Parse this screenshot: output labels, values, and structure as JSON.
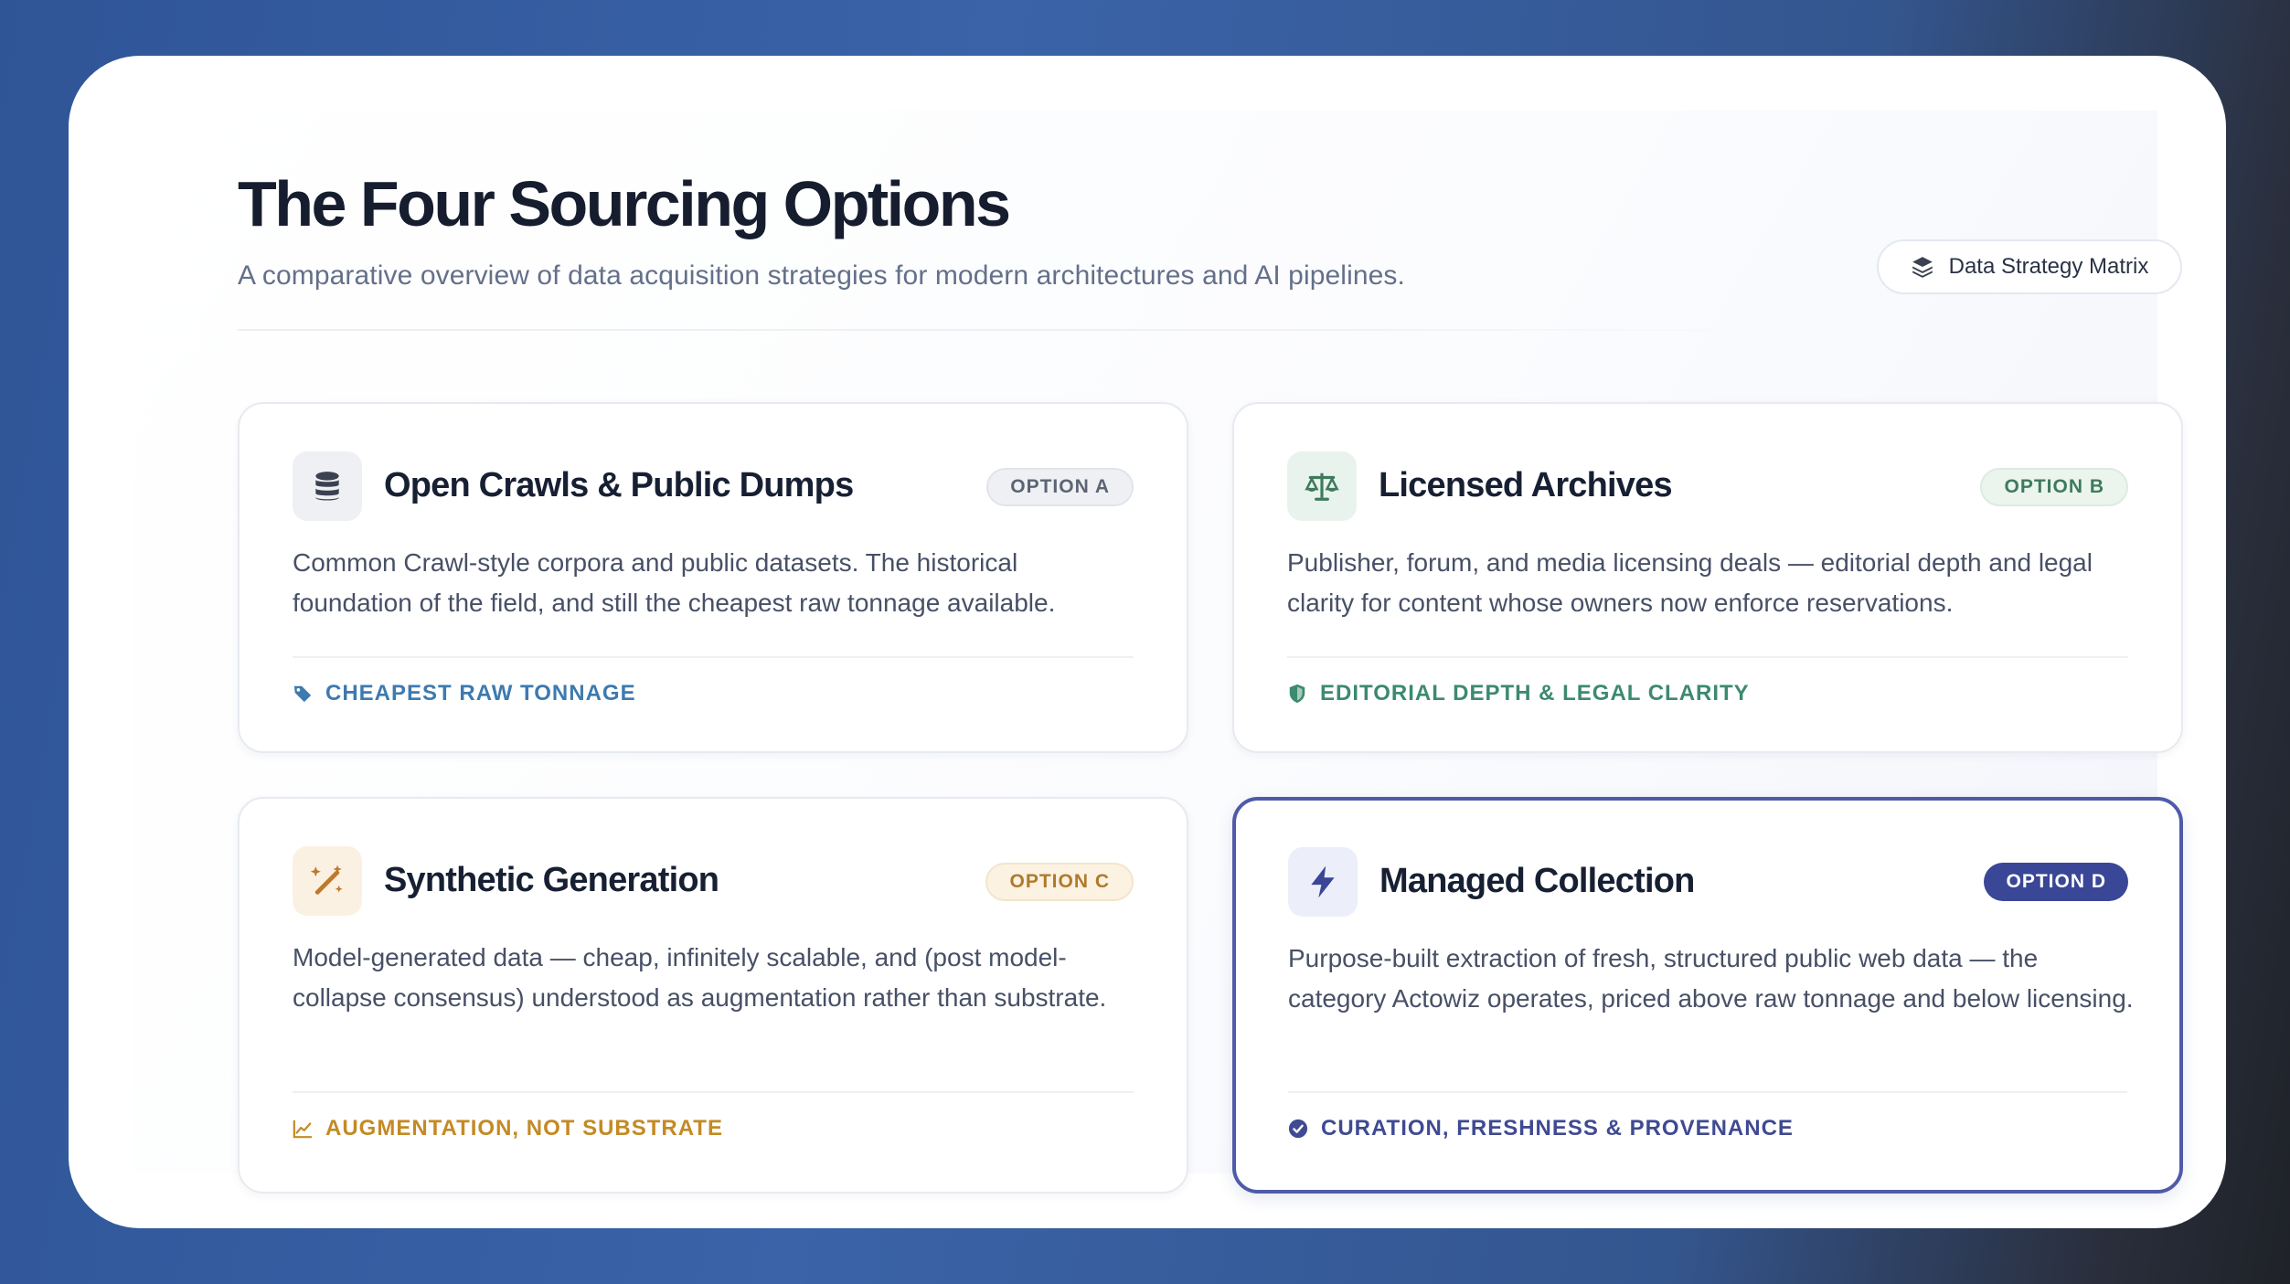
{
  "header": {
    "title": "The Four Sourcing Options",
    "subtitle": "A comparative overview of data acquisition strategies for modern architectures and AI pipelines.",
    "badge_label": "Data Strategy Matrix",
    "badge_icon": "layers-icon"
  },
  "colors": {
    "option_a_accent": "#3d7ab0",
    "option_b_accent": "#3d8a6e",
    "option_c_accent": "#c48a23",
    "option_d_accent": "#3a4696"
  },
  "cards": [
    {
      "icon": "database-icon",
      "title": "Open Crawls & Public Dumps",
      "pill": "OPTION A",
      "description": "Common Crawl-style corpora and public datasets. The historical foundation of the field, and still the cheapest raw tonnage available.",
      "tag_icon": "price-tag-icon",
      "tag": "CHEAPEST RAW TONNAGE"
    },
    {
      "icon": "scale-balance-icon",
      "title": "Licensed Archives",
      "pill": "OPTION B",
      "description": "Publisher, forum, and media licensing deals — editorial depth and legal clarity for content whose owners now enforce reservations.",
      "tag_icon": "shield-icon",
      "tag": "EDITORIAL DEPTH & LEGAL CLARITY"
    },
    {
      "icon": "magic-wand-icon",
      "title": "Synthetic Generation",
      "pill": "OPTION C",
      "description": "Model-generated data — cheap, infinitely scalable, and (post model-collapse consensus) understood as augmentation rather than substrate.",
      "tag_icon": "line-chart-icon",
      "tag": "AUGMENTATION, NOT SUBSTRATE"
    },
    {
      "icon": "lightning-bolt-icon",
      "title": "Managed Collection",
      "pill": "OPTION D",
      "description": "Purpose-built extraction of fresh, structured public web data — the category Actowiz operates, priced above raw tonnage and below licensing.",
      "tag_icon": "check-circle-icon",
      "tag": "CURATION, FRESHNESS & PROVENANCE"
    }
  ]
}
